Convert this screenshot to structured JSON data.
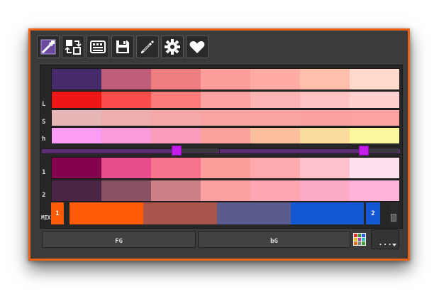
{
  "window": {
    "border_color": "#e8641b"
  },
  "toolbar": {
    "buttons": [
      {
        "icon": "eyedropper-icon"
      },
      {
        "icon": "swap-icon"
      },
      {
        "icon": "palette-icon"
      },
      {
        "icon": "save-icon"
      },
      {
        "icon": "pencil-icon"
      },
      {
        "icon": "gear-icon"
      },
      {
        "icon": "heart-icon"
      }
    ]
  },
  "rows": {
    "base": {
      "label": "",
      "colors": [
        "#462b6a",
        "#c05e7a",
        "#ee7d80",
        "#fd9e9c",
        "#ffaba6",
        "#ffbfac",
        "#ffd9ca"
      ]
    },
    "l": {
      "label": "L",
      "colors": [
        "#ec1616",
        "#fb4c4c",
        "#fb7a7a",
        "#fca3a2",
        "#fdb4b4",
        "#ffc3c3",
        "#ffd0cf"
      ]
    },
    "s": {
      "label": "S",
      "colors": [
        "#e7b7b8",
        "#eeaeae",
        "#f4a8a8",
        "#f8a4a3",
        "#f9a3a2",
        "#fba2a1",
        "#fca2a0"
      ]
    },
    "h": {
      "label": "h",
      "colors": [
        "#fb9cf5",
        "#fb9cda",
        "#fa9dbd",
        "#fba29e",
        "#fbbf9d",
        "#fcdc9d",
        "#fcf79c"
      ]
    },
    "sel1": {
      "label": "1",
      "colors": [
        "#84034c",
        "#e64d8a",
        "#f6748c",
        "#fb9e9c",
        "#fdaaae",
        "#fec0cc",
        "#fee0ee"
      ]
    },
    "sel2": {
      "label": "2",
      "colors": [
        "#4b2545",
        "#8c5264",
        "#cf7f86",
        "#fda0a0",
        "#fea6b1",
        "#feacc6",
        "#ffb3da"
      ]
    }
  },
  "sliders": [
    {
      "value": 0.76,
      "color": "#c21ee8"
    },
    {
      "value": 0.8,
      "color": "#c21ee8"
    }
  ],
  "mix": {
    "label": "MIX",
    "slot_left": {
      "label": "1",
      "color": "#ff5a05"
    },
    "slot_right": {
      "label": "2",
      "color": "#1358d2"
    },
    "segments": [
      "#ff5a05",
      "#a8554b",
      "#595c8c",
      "#1358d2"
    ]
  },
  "buttons": {
    "fg_label": "FG",
    "bg_label": "bG",
    "more_label": "..."
  },
  "grid_icon_colors": [
    "#e03030",
    "#30a030",
    "#3060e0",
    "#e0c020",
    "#c030c0",
    "#30c0c0",
    "#e07020",
    "#808080",
    "#40a040"
  ]
}
